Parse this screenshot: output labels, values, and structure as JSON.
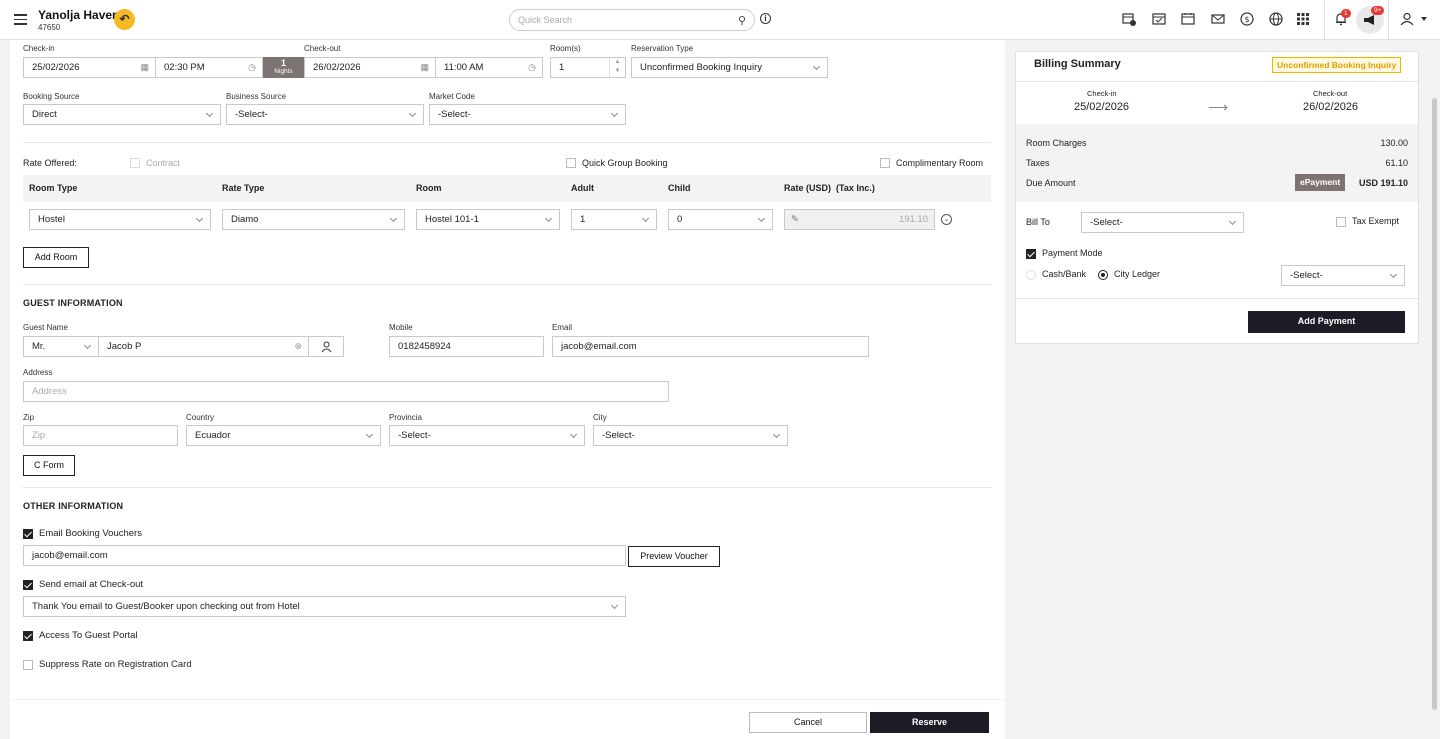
{
  "header": {
    "hotel_name": "Yanolja Haven",
    "hotel_code": "47650",
    "search_placeholder": "Quick Search",
    "notification_count": "1",
    "messages_count": "9+"
  },
  "stay": {
    "checkin_label": "Check-in",
    "checkin_date": "25/02/2026",
    "checkin_time": "02:30 PM",
    "nights_value": "1",
    "nights_label": "Nights",
    "checkout_label": "Check-out",
    "checkout_date": "26/02/2026",
    "checkout_time": "11:00 AM",
    "rooms_label": "Room(s)",
    "rooms_value": "1",
    "reservation_type_label": "Reservation Type",
    "reservation_type_value": "Unconfirmed Booking Inquiry"
  },
  "source": {
    "booking_source_label": "Booking Source",
    "booking_source_value": "Direct",
    "business_source_label": "Business Source",
    "business_source_value": "-Select-",
    "market_code_label": "Market Code",
    "market_code_value": "-Select-"
  },
  "rate": {
    "rate_offered_label": "Rate Offered:",
    "contract_label": "Contract",
    "quick_group_label": "Quick Group Booking",
    "complimentary_label": "Complimentary Room",
    "columns": [
      "Room Type",
      "Rate Type",
      "Room",
      "Adult",
      "Child",
      "Rate (USD)",
      "(Tax Inc.)"
    ],
    "row": {
      "room_type": "Hostel",
      "rate_type": "Diamo",
      "room": "Hostel 101-1",
      "adult": "1",
      "child": "0",
      "rate": "191.10"
    },
    "add_room_label": "Add Room"
  },
  "guest": {
    "section_title": "GUEST INFORMATION",
    "guest_name_label": "Guest Name",
    "salutation": "Mr.",
    "name": "Jacob P",
    "mobile_label": "Mobile",
    "mobile": "0182458924",
    "email_label": "Email",
    "email": "jacob@email.com",
    "address_label": "Address",
    "address_placeholder": "Address",
    "zip_label": "Zip",
    "zip_placeholder": "Zip",
    "country_label": "Country",
    "country": "Ecuador",
    "province_label": "Provincia",
    "province": "-Select-",
    "city_label": "City",
    "city": "-Select-",
    "cform_label": "C Form"
  },
  "other": {
    "section_title": "OTHER INFORMATION",
    "email_vouchers_label": "Email Booking Vouchers",
    "voucher_email": "jacob@email.com",
    "preview_voucher_label": "Preview Voucher",
    "send_checkout_label": "Send email at Check-out",
    "checkout_template": "Thank You email to Guest/Booker upon checking out from Hotel",
    "guest_portal_label": "Access To Guest Portal",
    "suppress_rate_label": "Suppress Rate on Registration Card"
  },
  "footer": {
    "cancel_label": "Cancel",
    "reserve_label": "Reserve"
  },
  "billing": {
    "title": "Billing Summary",
    "status_badge": "Unconfirmed Booking Inquiry",
    "checkin_label": "Check-in",
    "checkin_date": "25/02/2026",
    "checkout_label": "Check-out",
    "checkout_date": "26/02/2026",
    "room_charges_label": "Room Charges",
    "room_charges": "130.00",
    "taxes_label": "Taxes",
    "taxes": "61.10",
    "due_label": "Due Amount",
    "epayment_label": "ePayment",
    "due_amount": "USD 191.10",
    "bill_to_label": "Bill To",
    "bill_to_value": "-Select-",
    "tax_exempt_label": "Tax Exempt",
    "payment_mode_label": "Payment Mode",
    "cash_bank_label": "Cash/Bank",
    "city_ledger_label": "City Ledger",
    "ledger_select": "-Select-",
    "add_payment_label": "Add Payment"
  },
  "colors": {
    "accent": "#f5b921",
    "dark_button": "#1c1b26",
    "badge_text": "#e0a100"
  }
}
